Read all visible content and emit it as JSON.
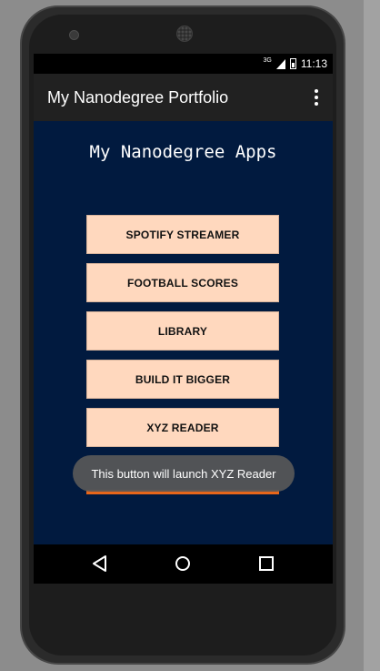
{
  "status_bar": {
    "network": "3G",
    "time": "11:13",
    "icons": [
      "signal-icon",
      "battery-icon"
    ]
  },
  "app_bar": {
    "title": "My Nanodegree Portfolio",
    "menu_icon": "overflow-menu-icon"
  },
  "main": {
    "heading": "My Nanodegree Apps",
    "buttons": [
      {
        "label": "SPOTIFY STREAMER"
      },
      {
        "label": "FOOTBALL SCORES"
      },
      {
        "label": "LIBRARY"
      },
      {
        "label": "BUILD IT BIGGER"
      },
      {
        "label": "XYZ READER"
      }
    ]
  },
  "toast": {
    "message": "This button will launch XYZ Reader"
  },
  "nav_bar": {
    "icons": [
      "back-icon",
      "home-icon",
      "recents-icon"
    ]
  },
  "colors": {
    "screen_background": "#011a3f",
    "button_background": "#ffd8be",
    "accent": "#e8661a"
  }
}
